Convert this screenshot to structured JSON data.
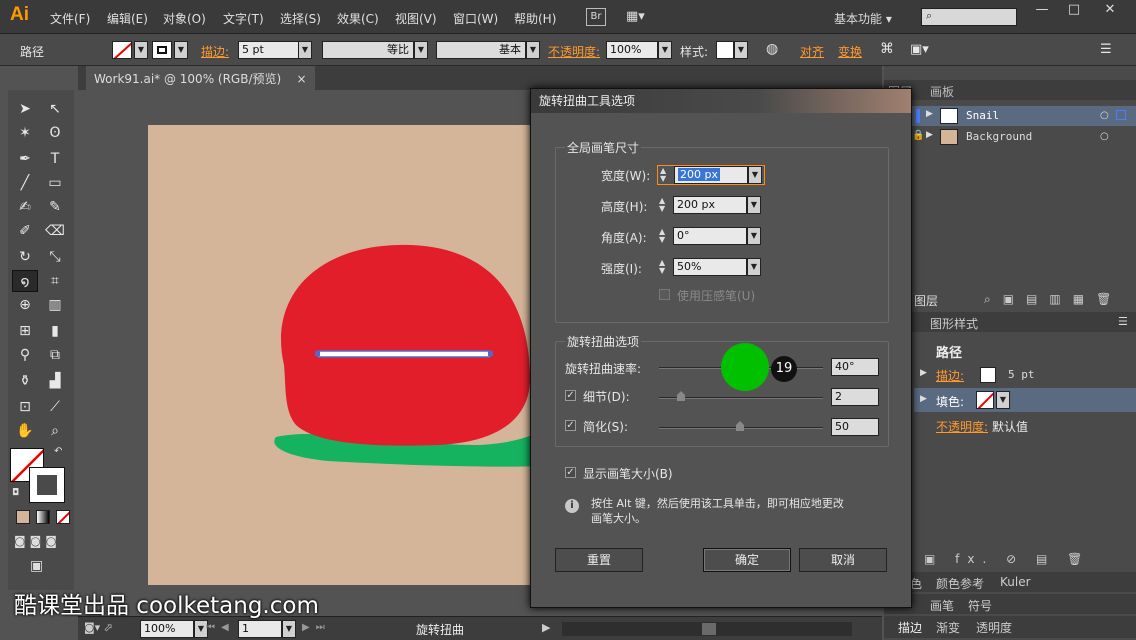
{
  "app": {
    "logo": "Ai",
    "workspace": "基本功能"
  },
  "menu": [
    "文件(F)",
    "编辑(E)",
    "对象(O)",
    "文字(T)",
    "选择(S)",
    "效果(C)",
    "视图(V)",
    "窗口(W)",
    "帮助(H)"
  ],
  "menu_badge": "Br",
  "control": {
    "selection": "路径",
    "stroke_label": "描边:",
    "stroke_weight": "5 pt",
    "profile": "等比",
    "brush": "基本",
    "opacity_label": "不透明度:",
    "opacity": "100%",
    "style_label": "样式:",
    "align": "对齐",
    "transform": "变换"
  },
  "doc_tab": {
    "title": "Work91.ai* @ 100% (RGB/预览)",
    "close": "×"
  },
  "layers": {
    "tabs": [
      "图层",
      "画板"
    ],
    "items": [
      "Snail",
      "Background"
    ],
    "footer": "图层"
  },
  "appearance": {
    "tabs": [
      "图形样式"
    ],
    "title": "路径",
    "stroke_label": "描边:",
    "stroke_value": "5 pt",
    "fill_label": "填色:",
    "opacity_label": "不透明度:",
    "opacity_value": "默认值"
  },
  "bottom_panels": {
    "row1": [
      "色",
      "颜色参考",
      "Kuler"
    ],
    "row2": [
      "画笔",
      "符号"
    ],
    "row3": [
      "描边",
      "渐变",
      "透明度"
    ]
  },
  "dialog": {
    "title": "旋转扭曲工具选项",
    "global_group": "全局画笔尺寸",
    "width_label": "宽度(W):",
    "width_value": "200 px",
    "height_label": "高度(H):",
    "height_value": "200 px",
    "angle_label": "角度(A):",
    "angle_value": "0°",
    "intensity_label": "强度(I):",
    "intensity_value": "50%",
    "pressure_label": "使用压感笔(U)",
    "twirl_group": "旋转扭曲选项",
    "rate_label": "旋转扭曲速率:",
    "rate_value": "40°",
    "detail_label": "细节(D):",
    "detail_value": "2",
    "simplify_label": "简化(S):",
    "simplify_value": "50",
    "show_size_label": "显示画笔大小(B)",
    "info_text_1": "按住 Alt 键，然后使用该工具单击，即可相应地更改",
    "info_text_2": "画笔大小。",
    "reset": "重置",
    "ok": "确定",
    "cancel": "取消"
  },
  "cursor_badge": "19",
  "status": {
    "zoom": "100%",
    "page": "1",
    "tool": "旋转扭曲"
  },
  "watermark": "酷课堂出品 coolketang.com"
}
